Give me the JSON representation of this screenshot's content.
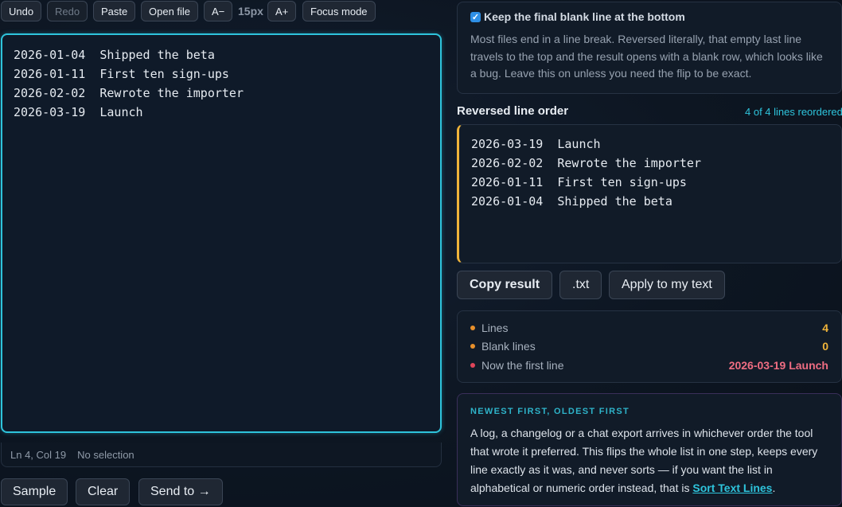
{
  "toolbar": {
    "undo": "Undo",
    "redo": "Redo",
    "paste": "Paste",
    "open_file": "Open file",
    "font_decrease": "A−",
    "font_size": "15px",
    "font_increase": "A+",
    "focus_mode": "Focus mode"
  },
  "editor": {
    "content": "2026-01-04  Shipped the beta\n2026-01-11  First ten sign-ups\n2026-02-02  Rewrote the importer\n2026-03-19  Launch"
  },
  "status": {
    "position": "Ln 4, Col 19",
    "selection": "No selection"
  },
  "bottom_buttons": {
    "sample": "Sample",
    "clear": "Clear",
    "send_to": "Send to →"
  },
  "option": {
    "checked": true,
    "label": "Keep the final blank line at the bottom",
    "description": "Most files end in a line break. Reversed literally, that empty last line travels to the top and the result opens with a blank row, which looks like a bug. Leave this on unless you need the flip to be exact."
  },
  "output": {
    "title": "Reversed line order",
    "count": "4 of 4 lines reordered",
    "content": "2026-03-19  Launch\n2026-02-02  Rewrote the importer\n2026-01-11  First ten sign-ups\n2026-01-04  Shipped the beta"
  },
  "actions": {
    "copy": "Copy result",
    "txt": ".txt",
    "apply": "Apply to my text"
  },
  "stats": [
    {
      "label": "Lines",
      "value": "4",
      "dot_color": "#e8902b",
      "value_color": "#f0b43a"
    },
    {
      "label": "Blank lines",
      "value": "0",
      "dot_color": "#e8902b",
      "value_color": "#f0b43a"
    },
    {
      "label": "Now the first line",
      "value": "2026-03-19 Launch",
      "dot_color": "#e0455a",
      "value_color": "#ef6d82"
    }
  ],
  "info": {
    "kicker": "NEWEST FIRST, OLDEST FIRST",
    "text": "A log, a changelog or a chat export arrives in whichever order the tool that wrote it preferred. This flips the whole list in one step, keeps every line exactly as it was, and never sorts — if you want the list in alphabetical or numeric order instead, that is ",
    "link": "Sort Text Lines",
    "end": "."
  },
  "colors": {
    "accent": "#2ec4dc",
    "highlight": "#f0b43a",
    "checkbox": "#2e8fe6"
  }
}
